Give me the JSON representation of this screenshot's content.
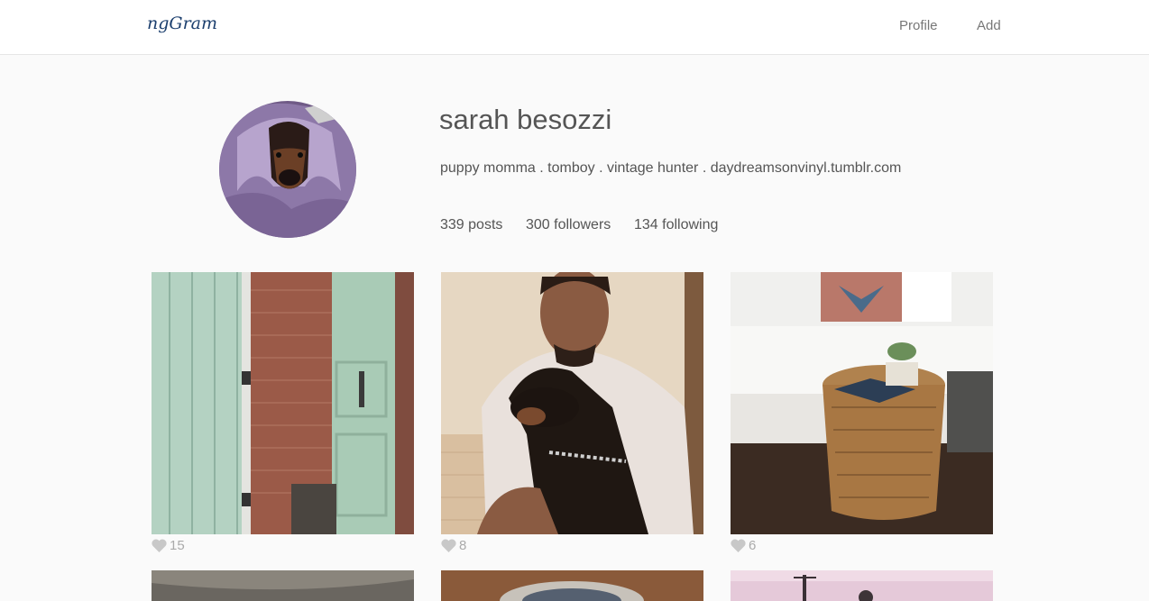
{
  "navbar": {
    "brand": "ngGram",
    "links": [
      "Profile",
      "Add"
    ]
  },
  "profile": {
    "name": "sarah besozzi",
    "bio": "puppy momma . tomboy . vintage hunter . daydreamsonvinyl.tumblr.com",
    "stats": {
      "posts": "339 posts",
      "followers": "300 followers",
      "following": "134 following"
    }
  },
  "posts": [
    {
      "likes": "15"
    },
    {
      "likes": "8"
    },
    {
      "likes": "6"
    }
  ],
  "colors": {
    "background": "#fafafa",
    "brand": "#1c3f6e",
    "like_icon": "#c8c8c8"
  },
  "icons": {
    "like": "heart-icon"
  }
}
